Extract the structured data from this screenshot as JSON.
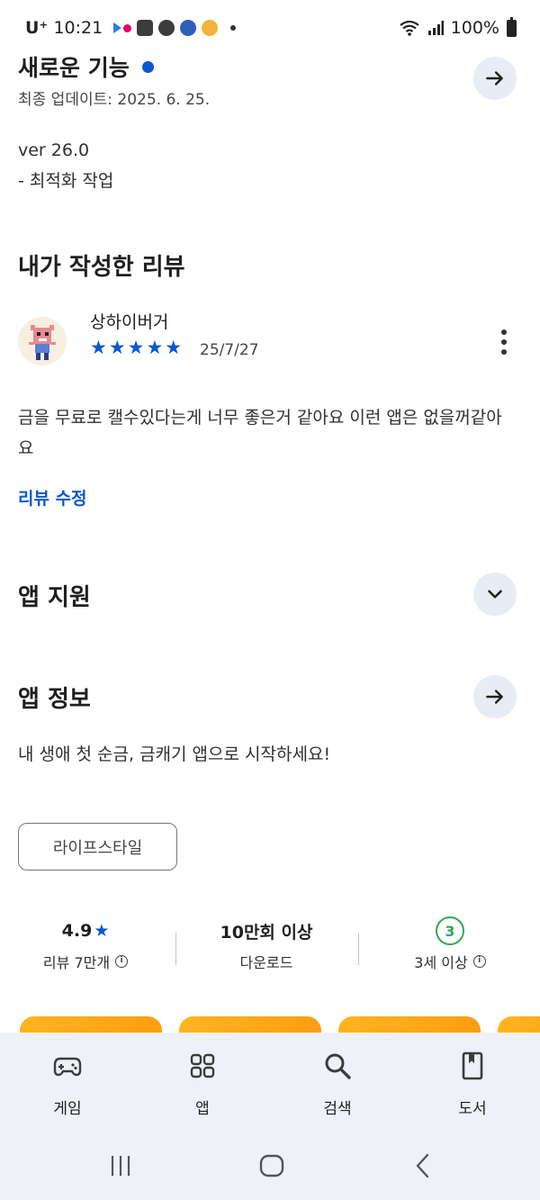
{
  "status_bar": {
    "carrier": "U⁺",
    "time": "10:21",
    "battery": "100%",
    "notification_icons": [
      "flickr-icon",
      "gallery-icon",
      "v-icon",
      "pixel-app-icon",
      "money-app-icon"
    ]
  },
  "whats_new": {
    "title": "새로운 기능",
    "updated": "최종 업데이트: 2025. 6. 25.",
    "notes": [
      "ver 26.0",
      "- 최적화 작업"
    ]
  },
  "my_review": {
    "heading": "내가 작성한 리뷰",
    "reviewer": "상하이버거",
    "stars": "★★★★★",
    "rating": 5,
    "date": "25/7/27",
    "body": "금을 무료로 캘수있다는게 너무 좋은거 같아요 이런 앱은 없을꺼같아요",
    "edit_label": "리뷰 수정"
  },
  "app_support": {
    "heading": "앱 지원"
  },
  "app_info": {
    "heading": "앱 정보",
    "description": "내 생애 첫 순금, 금캐기 앱으로 시작하세요!",
    "category_chip": "라이프스타일"
  },
  "stats": {
    "rating_value": "4.9",
    "rating_star": "★",
    "rating_label": "리뷰 7만개",
    "downloads_value": "10만회 이상",
    "downloads_label": "다운로드",
    "age_badge": "3",
    "age_label": "3세 이상",
    "info_glyph": "i"
  },
  "bottom_nav": {
    "items": [
      {
        "label": "게임",
        "icon": "gamepad-icon"
      },
      {
        "label": "앱",
        "icon": "apps-grid-icon"
      },
      {
        "label": "검색",
        "icon": "search-icon"
      },
      {
        "label": "도서",
        "icon": "book-icon"
      }
    ]
  },
  "colors": {
    "accent_blue": "#0b57d0",
    "age_green": "#34a853",
    "nav_background": "#eef1f7",
    "round_button": "#e8ecf4"
  }
}
